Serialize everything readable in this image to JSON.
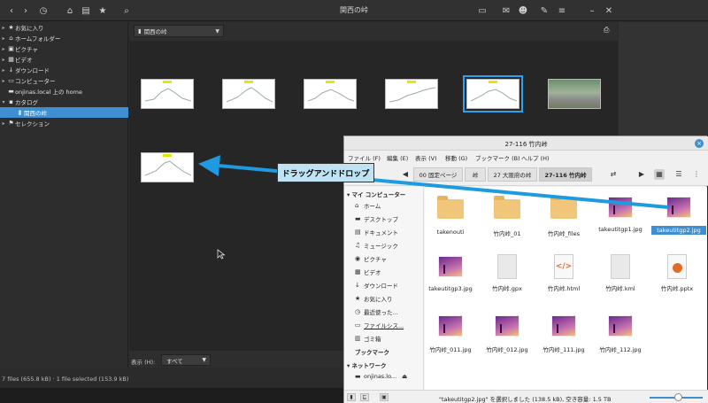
{
  "app": {
    "title": "関西の峠",
    "path_label": "関西の峠",
    "filter_label": "表示 (H):",
    "filter_value": "すべて",
    "status": "7 files (655.8 kB)  ·  1 file selected (153.9 kB)"
  },
  "sidebar": {
    "items": [
      {
        "label": "お気に入り",
        "icon": "star-icon"
      },
      {
        "label": "ホームフォルダー",
        "icon": "home-icon"
      },
      {
        "label": "ピクチャ",
        "icon": "picture-icon"
      },
      {
        "label": "ビデオ",
        "icon": "video-icon"
      },
      {
        "label": "ダウンロード",
        "icon": "download-icon"
      },
      {
        "label": "コンピューター",
        "icon": "computer-icon"
      },
      {
        "label": "onjinas.local 上の home",
        "icon": "network-icon"
      },
      {
        "label": "カタログ",
        "icon": "catalog-icon"
      },
      {
        "label": "関西の峠",
        "icon": "catalog-item-icon",
        "selected": true
      },
      {
        "label": "セレクション",
        "icon": "flag-icon"
      }
    ]
  },
  "file_manager": {
    "title": "27-116 竹内峠",
    "menu": [
      "ファイル (F)",
      "編集 (E)",
      "表示 (V)",
      "移動 (G)",
      "ブックマーク (B)",
      "ヘルプ (H)"
    ],
    "breadcrumbs": [
      "00 固定ページ",
      "峠",
      "27 大阪府の峠",
      "27-116 竹内峠"
    ],
    "sidebar_heads": [
      "マイ コンピューター",
      "ブックマーク",
      "ネットワーク"
    ],
    "sidebar_items": [
      "ホーム",
      "デスクトップ",
      "ドキュメント",
      "ミュージック",
      "ピクチャ",
      "ビデオ",
      "ダウンロード",
      "お気に入り",
      "最近使った...",
      "ファイルシス...",
      "ゴミ箱",
      "onjinas.lo..."
    ],
    "files": [
      {
        "name": "takenouti",
        "type": "folder"
      },
      {
        "name": "竹内峠_01",
        "type": "folder"
      },
      {
        "name": "竹内峠_files",
        "type": "folder"
      },
      {
        "name": "takeutitgp1.jpg",
        "type": "image"
      },
      {
        "name": "takeutitgp2.jpg",
        "type": "image",
        "selected": true
      },
      {
        "name": "takeutitgp3.jpg",
        "type": "image"
      },
      {
        "name": "竹内峠.gpx",
        "type": "doc"
      },
      {
        "name": "竹内峠.html",
        "type": "html"
      },
      {
        "name": "竹内峠.kml",
        "type": "doc"
      },
      {
        "name": "竹内峠.pptx",
        "type": "pptx"
      },
      {
        "name": "竹内峠_011.jpg",
        "type": "image"
      },
      {
        "name": "竹内峠_012.jpg",
        "type": "image"
      },
      {
        "name": "竹内峠_111.jpg",
        "type": "image"
      },
      {
        "name": "竹内峠_112.jpg",
        "type": "image"
      }
    ],
    "status": "\"takeutitgp2.jpg\" を選択しました (138.5 kB), 空き容量: 1.5 TB"
  },
  "annotation": {
    "callout_text": "ドラッグアンドドロップ"
  },
  "colors": {
    "accent": "#3d8fd1",
    "callout_bg": "#bfe3f2",
    "arrow": "#1e9be0"
  }
}
